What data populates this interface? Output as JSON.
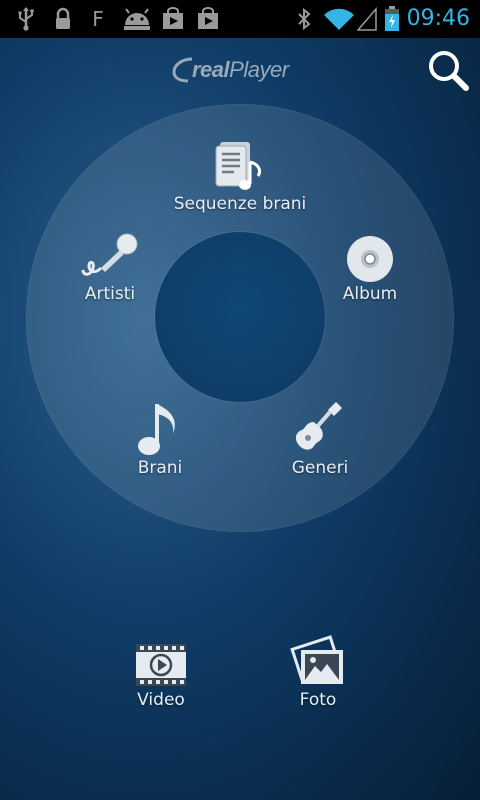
{
  "status_bar": {
    "time": "09:46",
    "icons": [
      "usb-icon",
      "lock-icon",
      "f-icon",
      "android-icon",
      "play-store-icon",
      "play-store-icon",
      "bluetooth-icon",
      "wifi-icon",
      "signal-icon",
      "battery-icon"
    ],
    "accent": "#33b5e5"
  },
  "header": {
    "logo_real": "real",
    "logo_player": "Player",
    "search_icon": "search-icon"
  },
  "wheel": {
    "items": [
      {
        "label": "Sequenze brani",
        "icon": "playlist-icon"
      },
      {
        "label": "Artisti",
        "icon": "microphone-icon"
      },
      {
        "label": "Album",
        "icon": "disc-icon"
      },
      {
        "label": "Brani",
        "icon": "music-note-icon"
      },
      {
        "label": "Generi",
        "icon": "guitar-icon"
      }
    ]
  },
  "bottom": {
    "items": [
      {
        "label": "Video",
        "icon": "film-icon"
      },
      {
        "label": "Foto",
        "icon": "photo-icon"
      }
    ]
  }
}
